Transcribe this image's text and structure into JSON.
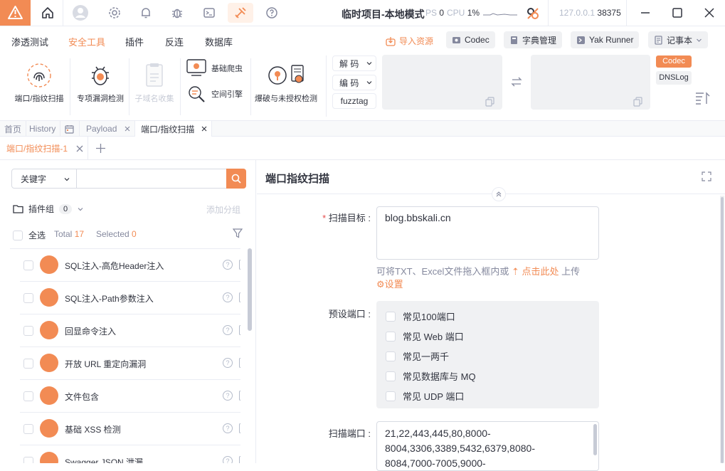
{
  "titlebar": {
    "project_title": "临时项目-本地模式",
    "ps_label": "PS",
    "ps_value": "0",
    "cpu_label": "CPU",
    "cpu_value": "1%",
    "host": "127.0.0.1",
    "port": "38375"
  },
  "menu": {
    "items": [
      "渗透测试",
      "安全工具",
      "插件",
      "反连",
      "数据库"
    ],
    "import_label": "导入资源",
    "codec_label": "Codec",
    "dict_label": "字典管理",
    "yak_runner_label": "Yak Runner",
    "notebook_label": "记事本"
  },
  "tools": {
    "port_scan": "端口/指纹扫描",
    "vuln_detect": "专项漏洞检测",
    "subdomain": "子域名收集",
    "crawler": "基础爬虫",
    "space_engine": "空间引擎",
    "brute": "爆破与未授权检测",
    "decode": "解 码",
    "encode": "编 码",
    "fuzztag": "fuzztag",
    "codec_tag": "Codec",
    "dnslog_tag": "DNSLog"
  },
  "tabs": {
    "home": "首页",
    "history": "History",
    "payload": "Payload",
    "active": "端口/指纹扫描",
    "sub_tab": "端口/指纹扫描-1"
  },
  "left": {
    "keyword_label": "关键字",
    "group_label": "插件组",
    "group_count": "0",
    "add_group": "添加分组",
    "select_all": "全选",
    "total_label": "Total",
    "total_value": "17",
    "selected_label": "Selected",
    "selected_value": "0",
    "plugins": [
      "SQL注入-高危Header注入",
      "SQL注入-Path参数注入",
      "回显命令注入",
      "开放 URL 重定向漏洞",
      "文件包含",
      "基础 XSS 检测",
      "Swagger JSON 泄漏"
    ]
  },
  "right": {
    "title": "端口指纹扫描",
    "target_label": "扫描目标",
    "target_value": "blog.bbskali.cn",
    "hint_prefix": "可将TXT、Excel文件拖入框内或",
    "hint_click": "点击此处",
    "hint_suffix": "上传",
    "settings_label": "设置",
    "preset_label": "预设端口",
    "presets": [
      "常见100端口",
      "常见 Web 端口",
      "常见一两千",
      "常见数据库与 MQ",
      "常见 UDP 端口"
    ],
    "ports_label": "扫描端口",
    "ports_line1": "21,22,443,445,80,8000-",
    "ports_line2": "8004,3306,3389,5432,6379,8080-",
    "ports_line3": "8084,7000-7005,9000-"
  },
  "colors": {
    "accent": "#f28b54",
    "text": "#31343f",
    "muted": "#85899e",
    "border": "#eaecf3"
  }
}
